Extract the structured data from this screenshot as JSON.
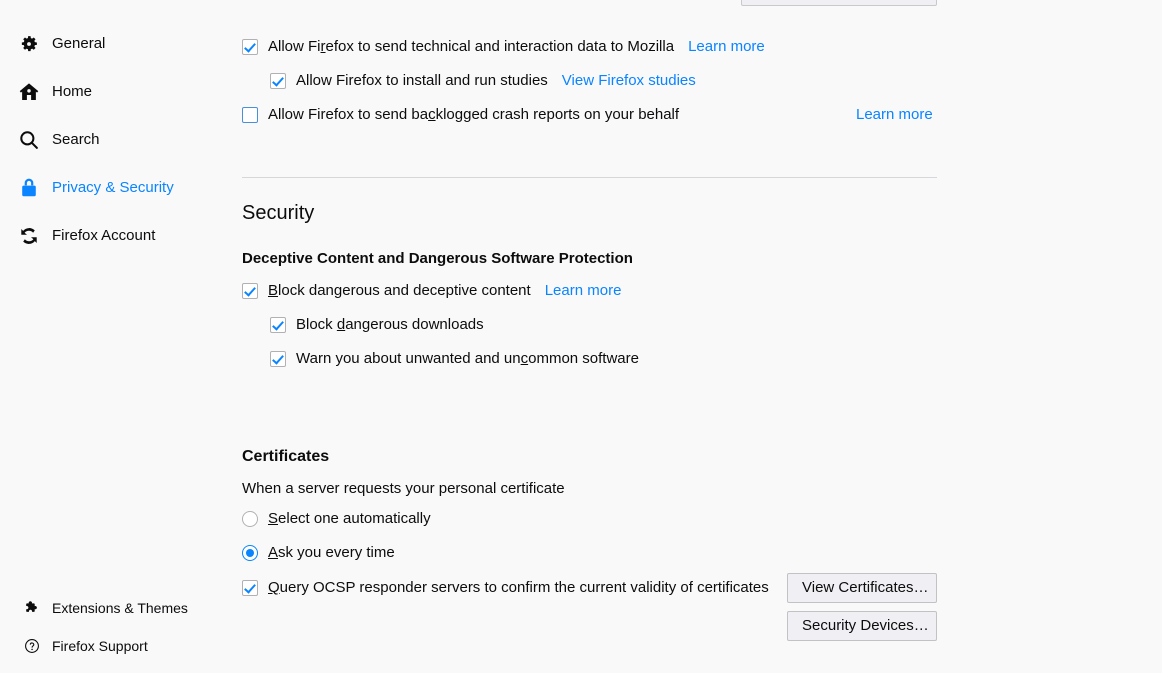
{
  "app": {
    "background": "#f9f9fa",
    "accent": "#0a84ff",
    "text_color": "#0c0c0d"
  },
  "sidebar": {
    "items": [
      {
        "label": "General",
        "icon": "gear-icon",
        "selected": false
      },
      {
        "label": "Home",
        "icon": "home-icon",
        "selected": false
      },
      {
        "label": "Search",
        "icon": "search-icon",
        "selected": false
      },
      {
        "label": "Privacy & Security",
        "icon": "lock-icon",
        "selected": true
      },
      {
        "label": "Firefox Account",
        "icon": "sync-icon",
        "selected": false
      }
    ],
    "footer_items": [
      {
        "label": "Extensions & Themes",
        "icon": "puzzle-piece-icon"
      },
      {
        "label": "Firefox Support",
        "icon": "question-circle-icon"
      }
    ]
  },
  "data_collection": {
    "telemetry": {
      "label_pre": "Allow Fi",
      "label_key": "r",
      "label_post": "efox to send technical and interaction data to Mozilla",
      "checked": true,
      "link": "Learn more"
    },
    "studies": {
      "label_pre": "Allow Firefox to install and run studies",
      "label_key": "",
      "label_post": "",
      "checked": true,
      "link": "View Firefox studies"
    },
    "crash_reports": {
      "label_pre": "Allow Firefox to send ba",
      "label_key": "c",
      "label_post": "klogged crash reports on your behalf",
      "checked": false,
      "link": "Learn more"
    }
  },
  "security": {
    "heading": "Security",
    "deceptive": {
      "subheading": "Deceptive Content and Dangerous Software Protection",
      "block_content": {
        "label_pre": "",
        "label_key": "B",
        "label_post": "lock dangerous and deceptive content",
        "checked": true,
        "link": "Learn more"
      },
      "block_downloads": {
        "label_pre": "Block ",
        "label_key": "d",
        "label_post": "angerous downloads",
        "checked": true
      },
      "warn_unwanted": {
        "label_pre": "Warn you about unwanted and un",
        "label_key": "c",
        "label_post": "ommon software",
        "checked": true
      }
    }
  },
  "certificates": {
    "heading": "Certificates",
    "description": "When a server requests your personal certificate",
    "options": [
      {
        "label_pre": "",
        "label_key": "S",
        "label_post": "elect one automatically",
        "selected": false
      },
      {
        "label_pre": "",
        "label_key": "A",
        "label_post": "sk you every time",
        "selected": true
      }
    ],
    "ocsp": {
      "label_pre": "",
      "label_key": "Q",
      "label_post": "uery OCSP responder servers to confirm the current validity of certificates",
      "checked": true
    },
    "buttons": [
      {
        "label_pre": "View ",
        "label_key": "C",
        "label_post": "ertificates…"
      },
      {
        "label_pre": "Security ",
        "label_key": "D",
        "label_post": "evices…"
      }
    ]
  }
}
